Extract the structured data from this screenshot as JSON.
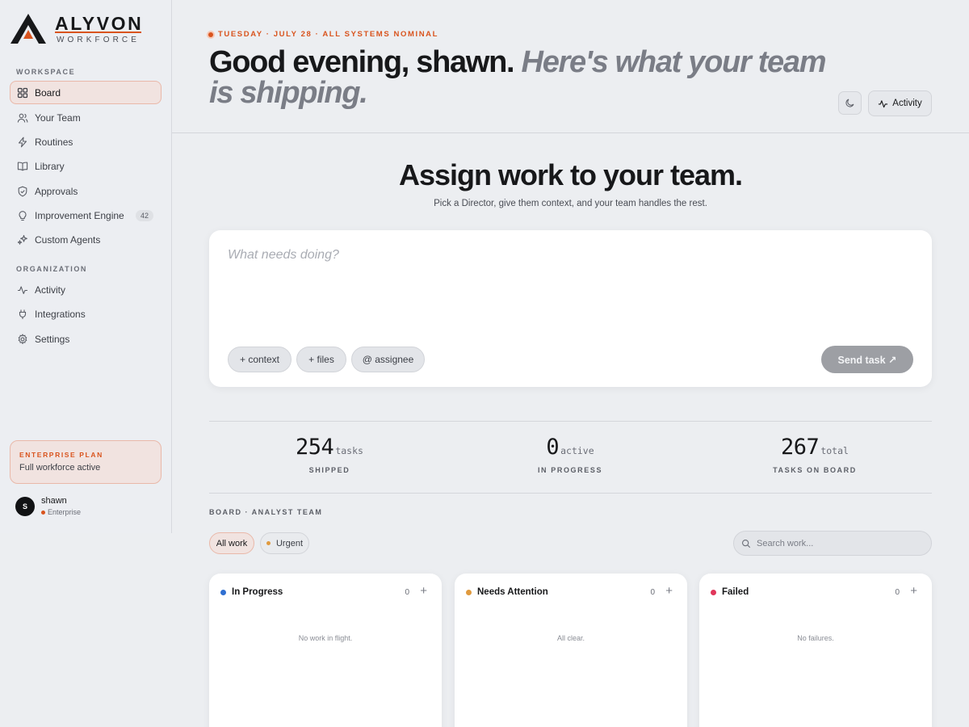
{
  "brand": {
    "name": "ALYVON",
    "sub": "WORKFORCE",
    "accent": "#d9541e"
  },
  "sidebar": {
    "workspace_heading": "WORKSPACE",
    "workspace_items": [
      {
        "label": "Board",
        "icon": "grid-icon",
        "active": true
      },
      {
        "label": "Your Team",
        "icon": "users-icon"
      },
      {
        "label": "Routines",
        "icon": "lightning-icon"
      },
      {
        "label": "Library",
        "icon": "book-icon"
      },
      {
        "label": "Approvals",
        "icon": "shield-check-icon"
      },
      {
        "label": "Improvement Engine",
        "icon": "lightbulb-icon",
        "badge": "42"
      },
      {
        "label": "Custom Agents",
        "icon": "sparkles-icon"
      }
    ],
    "organization_heading": "ORGANIZATION",
    "organization_items": [
      {
        "label": "Activity",
        "icon": "pulse-icon"
      },
      {
        "label": "Integrations",
        "icon": "plug-icon"
      },
      {
        "label": "Settings",
        "icon": "gear-icon"
      }
    ],
    "plan": {
      "title": "ENTERPRISE PLAN",
      "subtitle": "Full workforce active"
    },
    "user": {
      "initial": "S",
      "name": "shawn",
      "tier": "Enterprise"
    }
  },
  "header": {
    "status": "TUESDAY · JULY 28 · ALL SYSTEMS NOMINAL",
    "greeting": "Good evening, shawn.",
    "greeting_soft": "Here's what your team is shipping.",
    "activity_label": "Activity"
  },
  "composer": {
    "title": "Assign work to your team.",
    "subtitle": "Pick a Director, give them context, and your team handles the rest.",
    "placeholder": "What needs doing?",
    "chips": [
      "+ context",
      "+ files",
      "@ assignee"
    ],
    "send_label": "Send task ↗"
  },
  "stats": [
    {
      "value": "254",
      "unit": "tasks",
      "label": "SHIPPED"
    },
    {
      "value": "0",
      "unit": "active",
      "label": "IN PROGRESS"
    },
    {
      "value": "267",
      "unit": "total",
      "label": "TASKS ON BOARD"
    }
  ],
  "board": {
    "label": "BOARD · ANALYST TEAM",
    "filters": [
      "All work",
      "Urgent"
    ],
    "search_placeholder": "Search work...",
    "columns": [
      {
        "title": "In Progress",
        "count": "0",
        "empty": "No work in flight.",
        "color": "#2f6fd1"
      },
      {
        "title": "Needs Attention",
        "count": "0",
        "empty": "All clear.",
        "color": "#e09a3e"
      },
      {
        "title": "Failed",
        "count": "0",
        "empty": "No failures.",
        "color": "#e0365a"
      }
    ]
  }
}
